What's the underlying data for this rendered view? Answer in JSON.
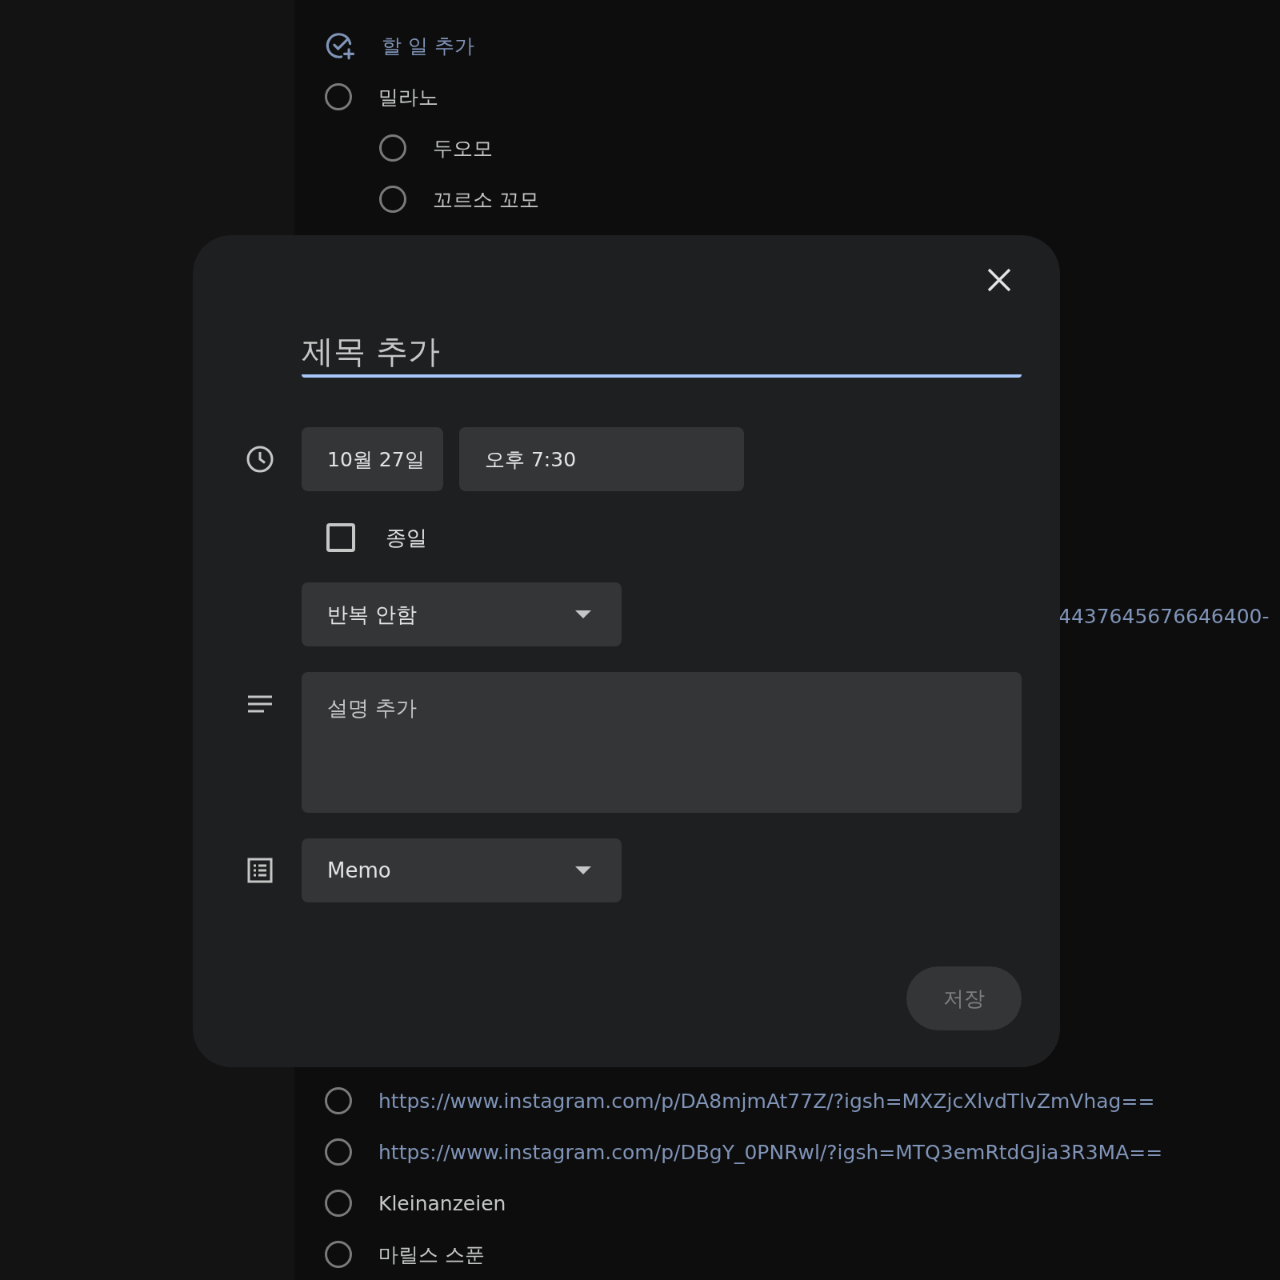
{
  "task_list": {
    "add_task": {
      "label": "할 일 추가"
    },
    "tasks_top": [
      {
        "title": "밀라노",
        "kind": "text",
        "completed": false,
        "children": [
          {
            "title": "두오모",
            "kind": "text",
            "completed": false
          },
          {
            "title": "꼬르소 꼬모",
            "kind": "text",
            "completed": false
          }
        ]
      }
    ],
    "partial_text": {
      "text": "4437645676646400-",
      "kind": "link"
    },
    "tasks_bottom": [
      {
        "title": "https://www.instagram.com/p/DA8mjmAt77Z/?igsh=MXZjcXlvdTlvZmVhag==",
        "kind": "link",
        "completed": false
      },
      {
        "title": "https://www.instagram.com/p/DBgY_0PNRwl/?igsh=MTQ3emRtdGJia3R3MA==",
        "kind": "link",
        "completed": false
      },
      {
        "title": "Kleinanzeien",
        "kind": "text",
        "completed": false
      },
      {
        "title": "마릴스 스푼",
        "kind": "text",
        "completed": false
      }
    ]
  },
  "dialog": {
    "title_field": {
      "placeholder": "제목 추가"
    },
    "date": "10월 27일",
    "time": "오후 7:30",
    "all_day": {
      "label": "종일",
      "checked": false
    },
    "repeat": {
      "value": "반복 안함"
    },
    "description": {
      "placeholder": "설명 추가"
    },
    "list": {
      "value": "Memo"
    },
    "save": {
      "label": "저장",
      "disabled": true
    }
  }
}
